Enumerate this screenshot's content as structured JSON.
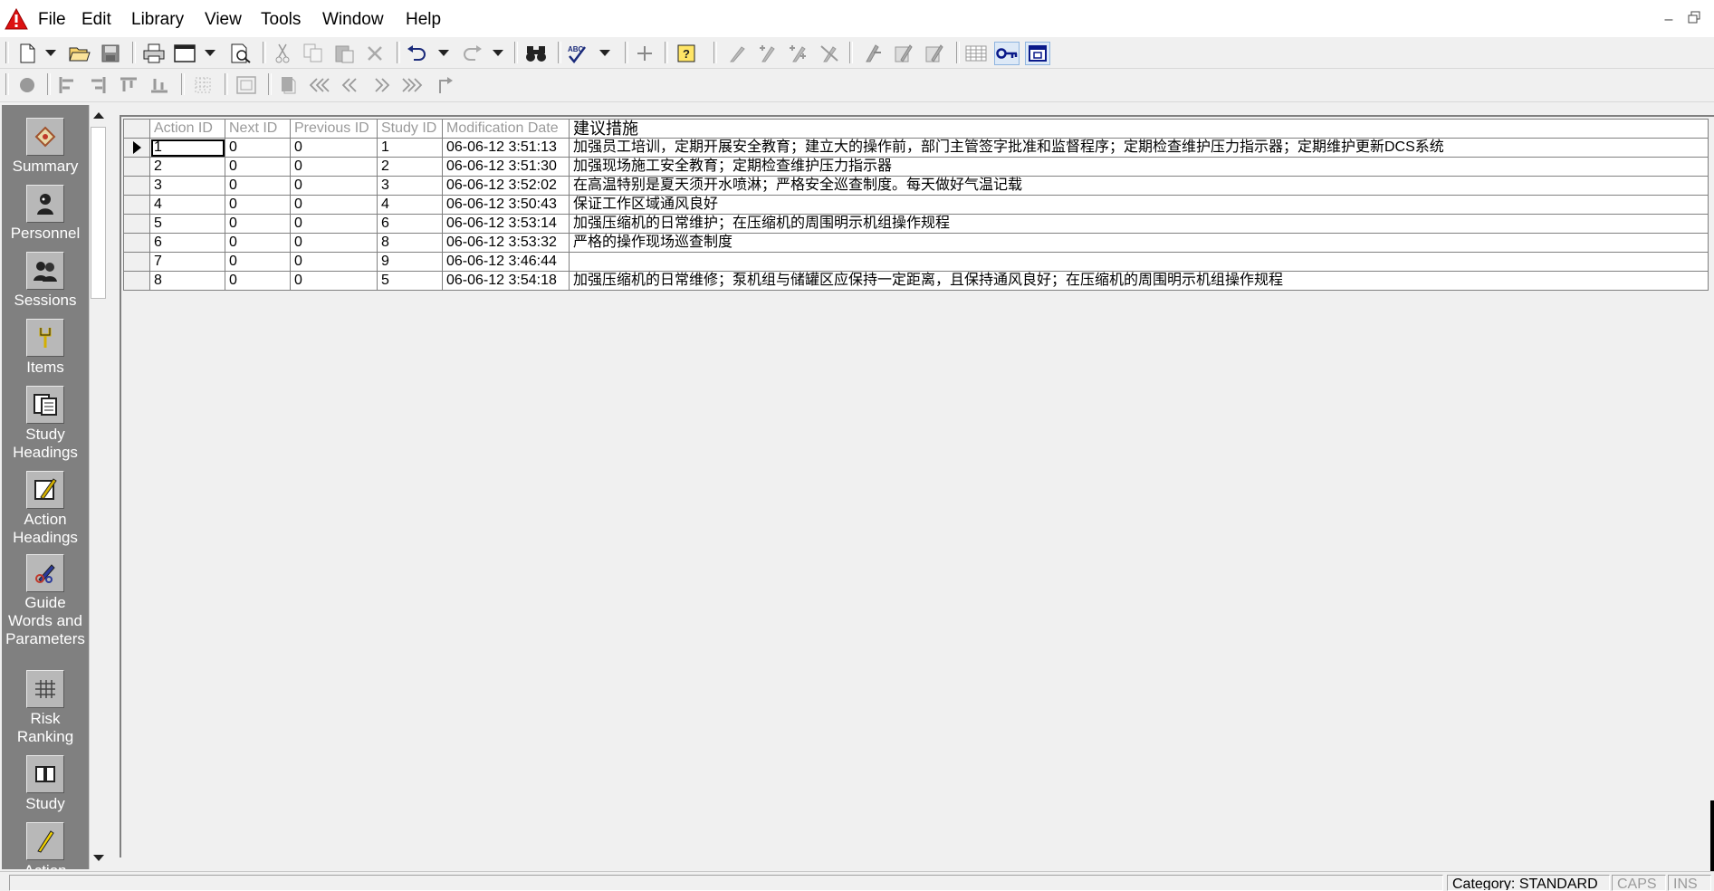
{
  "menu": [
    "File",
    "Edit",
    "Library",
    "View",
    "Tools",
    "Window",
    "Help"
  ],
  "toolbar1_icons": [
    "new-document-icon",
    "new-dropdown-icon",
    "open-folder-icon",
    "save-icon",
    "print-icon",
    "page-setup-icon",
    "page-setup-dropdown-icon",
    "print-preview-icon",
    "cut-icon",
    "copy-icon",
    "paste-icon",
    "delete-icon",
    "undo-icon",
    "undo-dropdown-icon",
    "redo-icon",
    "redo-dropdown-icon",
    "find-binoculars-icon",
    "spellcheck-icon",
    "spellcheck-dropdown-icon",
    "add-icon",
    "help-icon",
    "link-icon",
    "link-add-icon",
    "link-multiple-icon",
    "unlink-icon",
    "action-link-icon",
    "action-edit-icon",
    "action-remove-icon",
    "table-grid-icon",
    "key-icon",
    "form-view-icon"
  ],
  "toolbar2_icons": [
    "record-icon",
    "align-left-icon",
    "align-right-icon",
    "align-top-icon",
    "align-bottom-icon",
    "grid-dots-icon",
    "frame-icon",
    "bookmark-icon",
    "first-icon",
    "previous-icon",
    "next-icon",
    "last-icon",
    "goto-icon"
  ],
  "nav": [
    {
      "label": [
        "Summary"
      ],
      "icon": "summary-icon"
    },
    {
      "label": [
        "Personnel"
      ],
      "icon": "personnel-icon"
    },
    {
      "label": [
        "Sessions"
      ],
      "icon": "sessions-icon"
    },
    {
      "label": [
        "Items"
      ],
      "icon": "items-icon"
    },
    {
      "label": [
        "Study",
        "Headings"
      ],
      "icon": "study-headings-icon"
    },
    {
      "label": [
        "Action",
        "Headings"
      ],
      "icon": "action-headings-icon"
    },
    {
      "label": [
        "Guide",
        "Words and",
        "Parameters"
      ],
      "icon": "guide-words-icon"
    },
    {
      "label": [
        "Risk",
        "Ranking"
      ],
      "icon": "risk-ranking-icon"
    },
    {
      "label": [
        "Study"
      ],
      "icon": "study-icon"
    },
    {
      "label": [
        "Action"
      ],
      "icon": "action-icon"
    }
  ],
  "grid": {
    "columns": [
      "Action ID",
      "Next ID",
      "Previous ID",
      "Study ID",
      "Modification Date",
      "建议措施"
    ],
    "rows": [
      [
        "1",
        "0",
        "0",
        "1",
        "06-06-12 3:51:13",
        "加强员工培训，定期开展安全教育；建立大的操作前，部门主管签字批准和监督程序；定期检查维护压力指示器；定期维护更新DCS系统"
      ],
      [
        "2",
        "0",
        "0",
        "2",
        "06-06-12 3:51:30",
        "加强现场施工安全教育；定期检查维护压力指示器"
      ],
      [
        "3",
        "0",
        "0",
        "3",
        "06-06-12 3:52:02",
        "在高温特别是夏天须开水喷淋；严格安全巡查制度。每天做好气温记载"
      ],
      [
        "4",
        "0",
        "0",
        "4",
        "06-06-12 3:50:43",
        "保证工作区域通风良好"
      ],
      [
        "5",
        "0",
        "0",
        "6",
        "06-06-12 3:53:14",
        "加强压缩机的日常维护；在压缩机的周围明示机组操作规程"
      ],
      [
        "6",
        "0",
        "0",
        "8",
        "06-06-12 3:53:32",
        "严格的操作现场巡查制度"
      ],
      [
        "7",
        "0",
        "0",
        "9",
        "06-06-12 3:46:44",
        ""
      ],
      [
        "8",
        "0",
        "0",
        "5",
        "06-06-12 3:54:18",
        "加强压缩机的日常维修；泵机组与储罐区应保持一定距离，且保持通风良好；在压缩机的周围明示机组操作规程"
      ]
    ],
    "current_row": 0
  },
  "status": {
    "category": "Category: STANDARD",
    "caps": "CAPS",
    "ins": "INS"
  }
}
